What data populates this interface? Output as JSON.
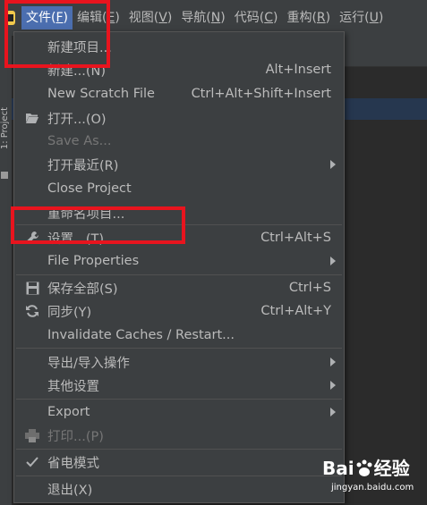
{
  "colors": {
    "menubar_bg": "#3c3f41",
    "editor_bg": "#2b2b2b",
    "active_menu": "#4b6eaf",
    "highlight": "#e8141e"
  },
  "menubar": {
    "items": [
      {
        "pre": "文件(",
        "mn": "F",
        "post": ")"
      },
      {
        "pre": "编辑(",
        "mn": "E",
        "post": ")"
      },
      {
        "pre": "视图(",
        "mn": "V",
        "post": ")"
      },
      {
        "pre": "导航(",
        "mn": "N",
        "post": ")"
      },
      {
        "pre": "代码(",
        "mn": "C",
        "post": ")"
      },
      {
        "pre": "重构(",
        "mn": "R",
        "post": ")"
      },
      {
        "pre": "运行(",
        "mn": "U",
        "post": ")"
      }
    ]
  },
  "sidebar": {
    "project_label": "1: Project"
  },
  "file_menu": {
    "new_project": "新建项目...",
    "new": "新建...(N)",
    "new_sc": "Alt+Insert",
    "new_scratch": "New Scratch File",
    "new_scratch_sc": "Ctrl+Alt+Shift+Insert",
    "open": "打开...(O)",
    "save_as": "Save As...",
    "open_recent": "打开最近(R)",
    "close_project": "Close Project",
    "rename_project": "重命名项目...",
    "settings": "设置...(T)",
    "settings_sc": "Ctrl+Alt+S",
    "file_properties": "File Properties",
    "save_all": "保存全部(S)",
    "save_all_sc": "Ctrl+S",
    "sync": "同步(Y)",
    "sync_sc": "Ctrl+Alt+Y",
    "invalidate": "Invalidate Caches / Restart...",
    "export_import": "导出/导入操作",
    "other_settings": "其他设置",
    "export": "Export",
    "print": "打印...(P)",
    "power_save": "省电模式",
    "exit": "退出(X)"
  },
  "icons": {
    "open": "folder-open-icon",
    "settings": "wrench-icon",
    "save_all": "floppy-disk-icon",
    "sync": "sync-icon",
    "print": "printer-icon",
    "power_save": "checkmark-icon"
  },
  "watermark": {
    "brand": "Bai",
    "brand_suffix": "经验",
    "url": "jingyan.baidu.com"
  }
}
